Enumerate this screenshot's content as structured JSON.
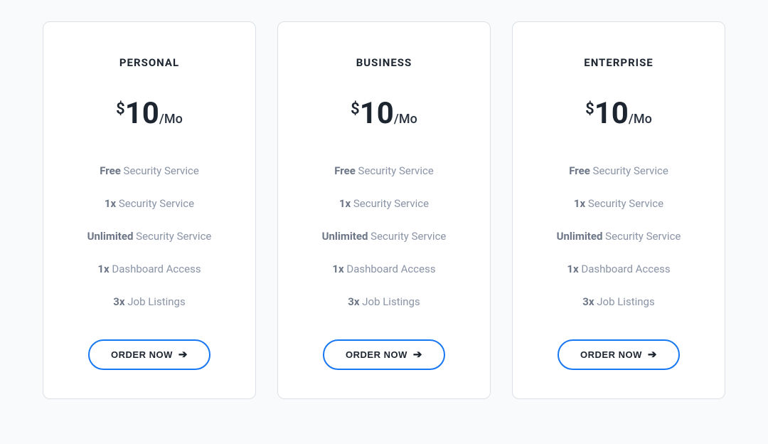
{
  "plans": [
    {
      "name": "PERSONAL",
      "currency": "$",
      "amount": "10",
      "period": "/Mo",
      "features": [
        {
          "bold": "Free",
          "rest": " Security Service"
        },
        {
          "bold": "1x",
          "rest": " Security Service"
        },
        {
          "bold": "Unlimited",
          "rest": " Security Service"
        },
        {
          "bold": "1x",
          "rest": " Dashboard Access"
        },
        {
          "bold": "3x",
          "rest": " Job Listings"
        }
      ],
      "cta": "ORDER NOW"
    },
    {
      "name": "BUSINESS",
      "currency": "$",
      "amount": "10",
      "period": "/Mo",
      "features": [
        {
          "bold": "Free",
          "rest": " Security Service"
        },
        {
          "bold": "1x",
          "rest": " Security Service"
        },
        {
          "bold": "Unlimited",
          "rest": " Security Service"
        },
        {
          "bold": "1x",
          "rest": " Dashboard Access"
        },
        {
          "bold": "3x",
          "rest": " Job Listings"
        }
      ],
      "cta": "ORDER NOW"
    },
    {
      "name": "ENTERPRISE",
      "currency": "$",
      "amount": "10",
      "period": "/Mo",
      "features": [
        {
          "bold": "Free",
          "rest": " Security Service"
        },
        {
          "bold": "1x",
          "rest": " Security Service"
        },
        {
          "bold": "Unlimited",
          "rest": " Security Service"
        },
        {
          "bold": "1x",
          "rest": " Dashboard Access"
        },
        {
          "bold": "3x",
          "rest": " Job Listings"
        }
      ],
      "cta": "ORDER NOW"
    }
  ]
}
